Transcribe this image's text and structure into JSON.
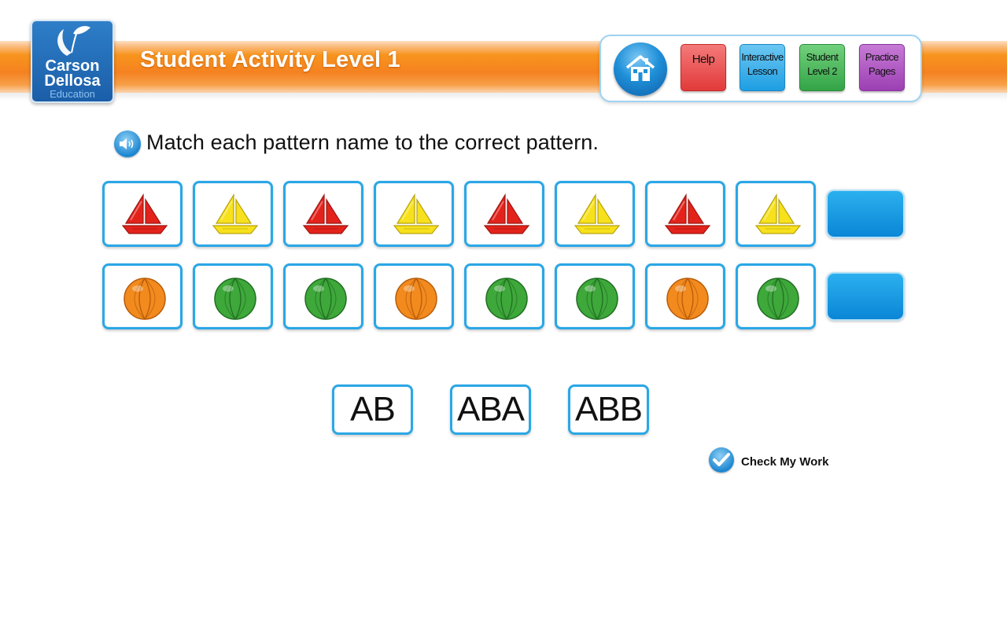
{
  "header": {
    "logo": {
      "line1": "Carson",
      "line2": "Dellosa",
      "line3": "Education"
    },
    "title": "Student Activity Level 1",
    "nav": {
      "home_icon": "house-icon",
      "help": "Help",
      "lesson_line1": "Interactive",
      "lesson_line2": "Lesson",
      "level2_line1": "Student",
      "level2_line2": "Level 2",
      "practice_line1": "Practice",
      "practice_line2": "Pages"
    }
  },
  "instruction": {
    "icon": "speaker-icon",
    "text": "Match each pattern name to the correct pattern."
  },
  "patterns": [
    {
      "items": [
        "red-sailboat",
        "yellow-sailboat",
        "red-sailboat",
        "yellow-sailboat",
        "red-sailboat",
        "yellow-sailboat",
        "red-sailboat",
        "yellow-sailboat"
      ]
    },
    {
      "items": [
        "orange-ball",
        "green-ball",
        "green-ball",
        "orange-ball",
        "green-ball",
        "green-ball",
        "orange-ball",
        "green-ball"
      ]
    }
  ],
  "choices": [
    "AB",
    "ABA",
    "ABB"
  ],
  "check": {
    "icon": "checkmark-icon",
    "label": "Check My Work"
  },
  "colors": {
    "banner_orange": "#f58220",
    "tile_border": "#2ba7e6",
    "drop_blue": "#0a86d6",
    "help_red": "#e23a3a",
    "lesson_blue": "#1e9ee3",
    "level2_green": "#33a447",
    "practice_purple": "#9c3fb3"
  }
}
